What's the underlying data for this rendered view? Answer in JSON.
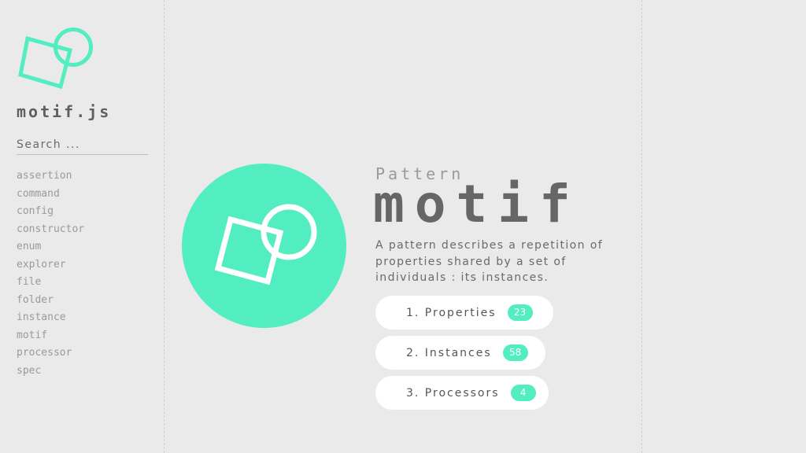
{
  "sidebar": {
    "logo_icon": "motif-logo-icon",
    "brand": "motif.js",
    "search": {
      "placeholder": "Search ...",
      "value": ""
    },
    "items": [
      {
        "label": "assertion"
      },
      {
        "label": "command"
      },
      {
        "label": "config"
      },
      {
        "label": "constructor"
      },
      {
        "label": "enum"
      },
      {
        "label": "explorer"
      },
      {
        "label": "file"
      },
      {
        "label": "folder"
      },
      {
        "label": "instance"
      },
      {
        "label": "motif"
      },
      {
        "label": "processor"
      },
      {
        "label": "spec"
      }
    ]
  },
  "main": {
    "hero_icon": "pattern-icon",
    "kicker": "Pattern",
    "title": "motif",
    "description": "A pattern describes a repetition of properties shared by a set of individuals : its instances.",
    "sections": [
      {
        "label": "1. Properties",
        "count": "23"
      },
      {
        "label": "2. Instances",
        "count": "58"
      },
      {
        "label": "3. Processors",
        "count": "4"
      }
    ]
  },
  "colors": {
    "accent": "#52edc1",
    "background": "#eaeaea",
    "text_dark": "#666666",
    "text_muted": "#9a9a9a",
    "pill_bg": "#ffffff"
  }
}
